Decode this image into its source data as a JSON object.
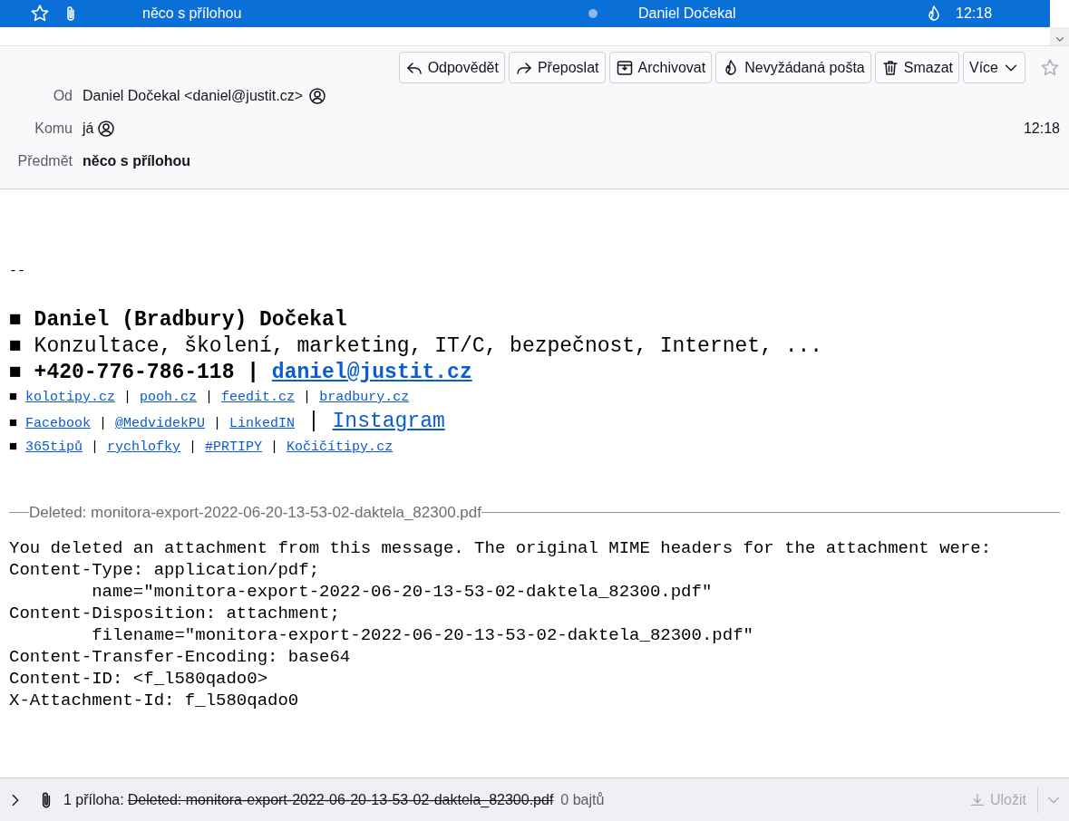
{
  "message_list": {
    "row": {
      "subject": "něco s přílohou",
      "sender": "Daniel Dočekal",
      "time": "12:18",
      "selected": true
    }
  },
  "toolbar": {
    "buttons": [
      {
        "kind": "reply",
        "label": "Odpovědět"
      },
      {
        "kind": "forward",
        "label": "Přeposlat"
      },
      {
        "kind": "archive",
        "label": "Archivovat"
      },
      {
        "kind": "junk",
        "label": "Nevyžádaná pošta"
      },
      {
        "kind": "delete",
        "label": "Smazat"
      },
      {
        "kind": "more",
        "label": "Více"
      }
    ],
    "starred": false
  },
  "headers": {
    "from": {
      "label": "Od",
      "value": "Daniel Dočekal <daniel@justit.cz>"
    },
    "to": {
      "label": "Komu",
      "value": "já"
    },
    "date": "12:18",
    "subject": {
      "label": "Předmět",
      "value": "něco s přílohou"
    }
  },
  "body": {
    "separator": "--",
    "signature": [
      {
        "kind": "large",
        "bold": true,
        "parts": [
          {
            "kind": "text",
            "text": "■ Daniel (Bradbury) Dočekal"
          }
        ]
      },
      {
        "kind": "large",
        "bold": false,
        "parts": [
          {
            "kind": "text",
            "text": "■ Konzultace, školení, marketing, IT/C, bezpečnost, Internet, ..."
          }
        ]
      },
      {
        "kind": "large",
        "bold": true,
        "parts": [
          {
            "kind": "text",
            "text": "■ +420-776-786-118 | "
          },
          {
            "kind": "link",
            "text": "daniel@justit.cz"
          }
        ]
      },
      {
        "kind": "small",
        "bold": false,
        "parts": [
          {
            "kind": "text",
            "text": "■ "
          },
          {
            "kind": "link",
            "text": "kolotipy.cz"
          },
          {
            "kind": "text",
            "text": " | "
          },
          {
            "kind": "link",
            "text": "pooh.cz"
          },
          {
            "kind": "text",
            "text": " | "
          },
          {
            "kind": "link",
            "text": "feedit.cz"
          },
          {
            "kind": "text",
            "text": " | "
          },
          {
            "kind": "link",
            "text": "bradbury.cz"
          }
        ]
      },
      {
        "kind": "small",
        "bold": false,
        "parts": [
          {
            "kind": "text",
            "text": "■ "
          },
          {
            "kind": "link",
            "text": "Facebook"
          },
          {
            "kind": "text",
            "text": " | "
          },
          {
            "kind": "link",
            "text": "@MedvidekPU"
          },
          {
            "kind": "text",
            "text": " | "
          },
          {
            "kind": "link",
            "text": "LinkedIN"
          },
          {
            "kind": "bigtext",
            "text": " | "
          },
          {
            "kind": "biglink",
            "text": "Instagram"
          }
        ]
      },
      {
        "kind": "small",
        "bold": false,
        "parts": [
          {
            "kind": "text",
            "text": "■ "
          },
          {
            "kind": "link",
            "text": "365tipů"
          },
          {
            "kind": "text",
            "text": " | "
          },
          {
            "kind": "link",
            "text": "rychlofky"
          },
          {
            "kind": "text",
            "text": " | "
          },
          {
            "kind": "link",
            "text": "#PRTIPY"
          },
          {
            "kind": "text",
            "text": " | "
          },
          {
            "kind": "link",
            "text": "Kočičítipy.cz"
          }
        ]
      }
    ],
    "deleted_attachment": {
      "legend": "Deleted: monitora-export-2022-06-20-13-53-02-daktela_82300.pdf",
      "lines": [
        "You deleted an attachment from this message. The original MIME headers for the attachment were:",
        "Content-Type: application/pdf;",
        "        name=\"monitora-export-2022-06-20-13-53-02-daktela_82300.pdf\"",
        "Content-Disposition: attachment;",
        "        filename=\"monitora-export-2022-06-20-13-53-02-daktela_82300.pdf\"",
        "Content-Transfer-Encoding: base64",
        "Content-ID: <f_l580qado0>",
        "X-Attachment-Id: f_l580qado0"
      ]
    }
  },
  "attachment_bar": {
    "expanded": false,
    "count": "1 příloha:",
    "filename": "Deleted: monitora-export-2022-06-20-13-53-02-daktela_82300.pdf",
    "deleted": true,
    "size": "0 bajtů",
    "save": {
      "label": "Uložit",
      "disabled": true
    }
  }
}
